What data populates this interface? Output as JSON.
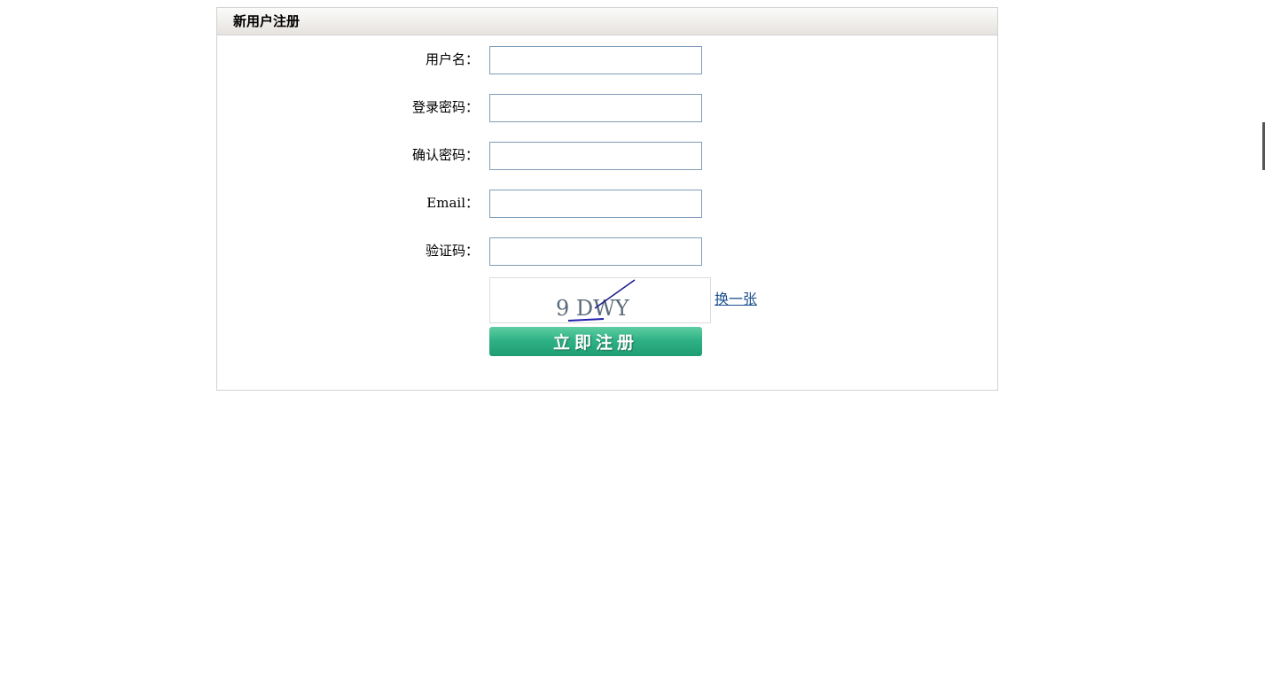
{
  "panel": {
    "title": "新用户注册"
  },
  "form": {
    "username_label": "用户名：",
    "password_label": "登录密码：",
    "confirm_password_label": "确认密码：",
    "email_label": "Email：",
    "captcha_label": "验证码：",
    "username_value": "",
    "password_value": "",
    "confirm_password_value": "",
    "email_value": "",
    "captcha_value": ""
  },
  "captcha": {
    "text": "9 DWY"
  },
  "actions": {
    "refresh_label": "换一张",
    "submit_label": "立即注册"
  },
  "colors": {
    "accent": "#2fb286",
    "link": "#1a4e8c",
    "input_border": "#7f9db9"
  }
}
